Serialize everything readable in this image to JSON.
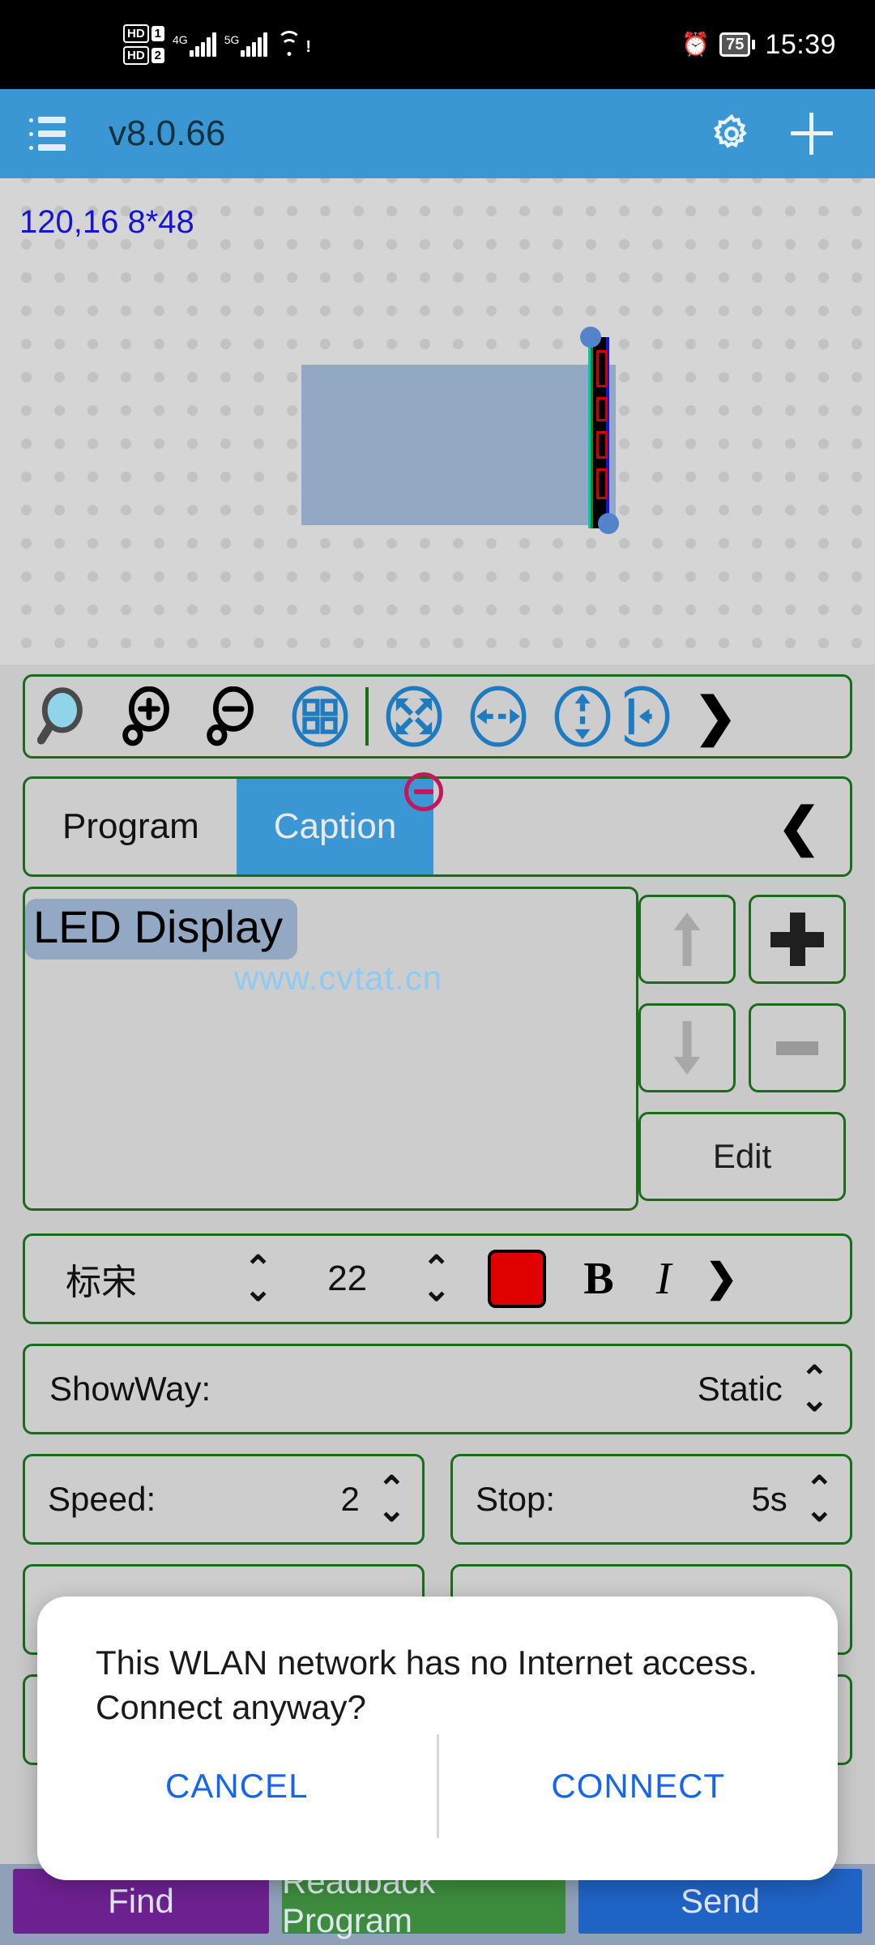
{
  "status_bar": {
    "hd1_label": "HD",
    "hd1_num": "1",
    "hd2_label": "HD",
    "hd2_num": "2",
    "net1": "4G",
    "net2": "5G",
    "wifi_warning": "!",
    "alarm_icon": "alarm-clock-icon",
    "battery": "75",
    "time": "15:39"
  },
  "app_bar": {
    "menu_icon": "list-menu-icon",
    "title": "v8.0.66",
    "settings_icon": "gear-icon",
    "add_icon": "plus-icon"
  },
  "canvas": {
    "coordinate_label": "120,16 8*48",
    "selection_handles": 2
  },
  "toolbar": {
    "items": [
      {
        "name": "magnifier-icon",
        "label": "Zoom"
      },
      {
        "name": "zoom-in-icon",
        "label": "Zoom In"
      },
      {
        "name": "zoom-out-icon",
        "label": "Zoom Out"
      },
      {
        "name": "grid-icon",
        "label": "Grid"
      },
      {
        "name": "fit-all-icon",
        "label": "Fit All"
      },
      {
        "name": "fit-width-icon",
        "label": "Fit Width"
      },
      {
        "name": "fit-height-icon",
        "label": "Fit Height"
      },
      {
        "name": "align-left-icon",
        "label": "Align Left"
      }
    ],
    "more_chevron": "❯"
  },
  "tabs": {
    "items": [
      {
        "label": "Program",
        "active": false
      },
      {
        "label": "Caption",
        "active": true
      }
    ],
    "delete_badge": "minus-circle-icon",
    "collapse_chevron": "❮"
  },
  "caption": {
    "items": [
      {
        "text": "LED Display",
        "selected": true
      }
    ],
    "watermark": "www.cvtat.cn",
    "move_up": "arrow-up-icon",
    "move_down": "arrow-down-icon",
    "add": "plus-icon",
    "remove": "minus-icon",
    "edit_label": "Edit"
  },
  "font_row": {
    "font_name": "标宋",
    "font_size": "22",
    "color": "#E00000",
    "bold_label": "B",
    "italic_label": "I",
    "more_chevron": "❯",
    "spinner_up": "⌃",
    "spinner_down": "⌄"
  },
  "settings": {
    "showway": {
      "label": "ShowWay:",
      "value": "Static"
    },
    "speed": {
      "label": "Speed:",
      "value": "2"
    },
    "stop": {
      "label": "Stop:",
      "value": "5s"
    }
  },
  "bottom_bar": {
    "find": "Find",
    "readback": "Readback Program",
    "send": "Send"
  },
  "dialog": {
    "message": "This WLAN network has no Internet access. Connect anyway?",
    "cancel": "CANCEL",
    "connect": "CONNECT"
  }
}
